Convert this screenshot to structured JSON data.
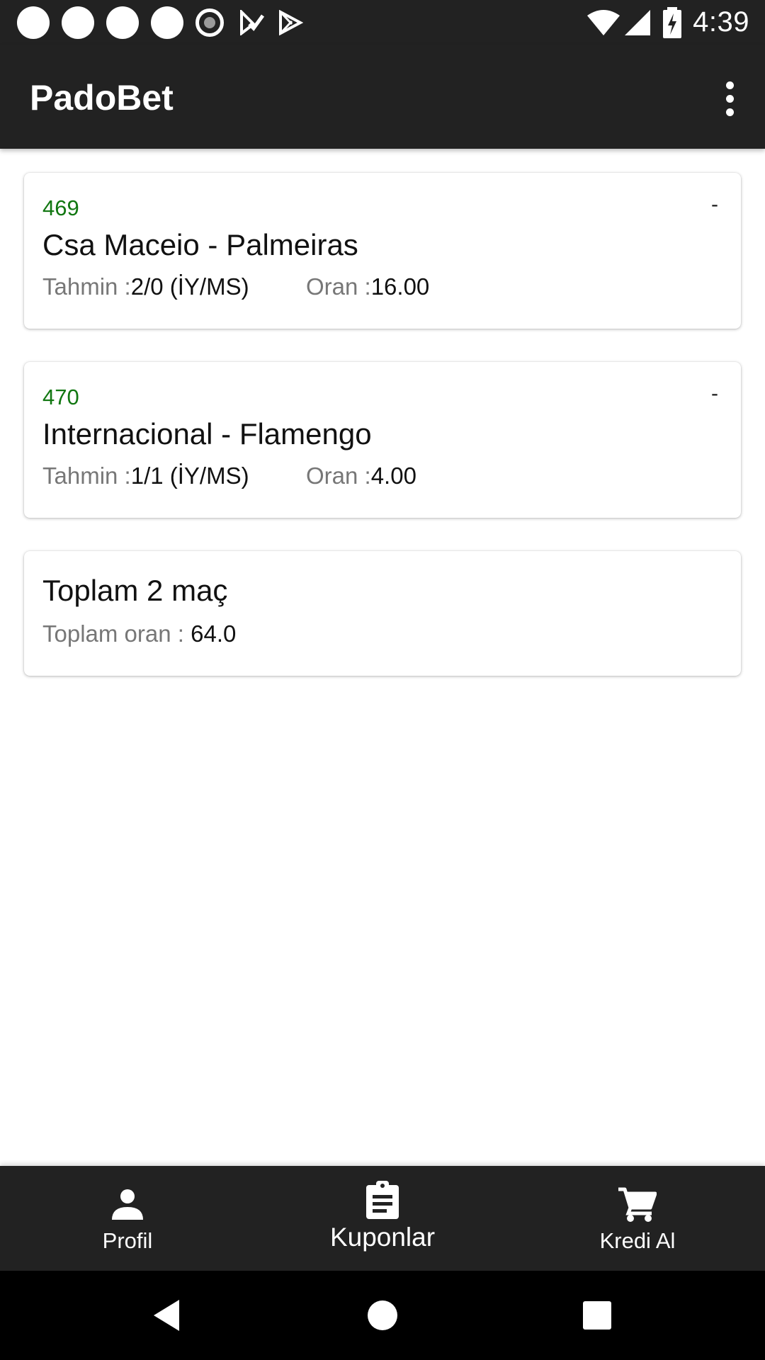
{
  "status_bar": {
    "time": "4:39",
    "icons": [
      "notification-dot-icon",
      "notification-dot-icon",
      "notification-dot-icon",
      "notification-dot-icon",
      "record-icon",
      "play-store-check-icon",
      "play-store-icon",
      "wifi-icon",
      "signal-icon",
      "battery-charging-icon"
    ]
  },
  "app_bar": {
    "title": "PadoBet",
    "menu_icon": "more-vert-icon"
  },
  "coupons": [
    {
      "number": "469",
      "status": "-",
      "match": "Csa Maceio - Palmeiras",
      "prediction_label": "Tahmin :",
      "prediction_value": "2/0 (İY/MS)",
      "odds_label": "Oran :",
      "odds_value": "16.00"
    },
    {
      "number": "470",
      "status": "-",
      "match": "Internacional - Flamengo",
      "prediction_label": "Tahmin :",
      "prediction_value": "1/1 (İY/MS)",
      "odds_label": "Oran :",
      "odds_value": "4.00"
    }
  ],
  "summary": {
    "title": "Toplam 2 maç",
    "total_odds_label": "Toplam oran : ",
    "total_odds_value": "64.0"
  },
  "bottom_nav": {
    "items": [
      {
        "label": "Profil",
        "icon": "person-icon",
        "active": false
      },
      {
        "label": "Kuponlar",
        "icon": "clipboard-icon",
        "active": true
      },
      {
        "label": "Kredi Al",
        "icon": "shopping-cart-icon",
        "active": false
      }
    ]
  },
  "system_nav": {
    "buttons": [
      "back-icon",
      "home-icon",
      "recents-icon"
    ]
  },
  "colors": {
    "bar_background": "#222222",
    "coupon_number": "#117711",
    "label_gray": "#777777"
  }
}
